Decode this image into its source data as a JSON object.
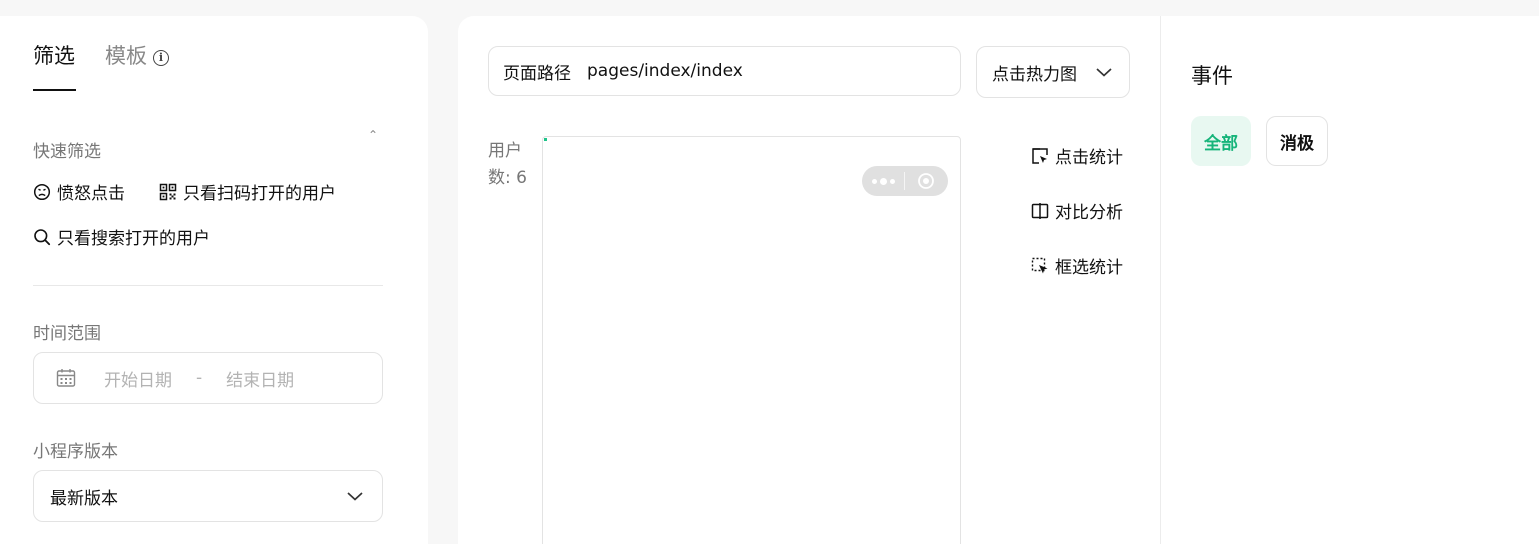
{
  "filter_panel": {
    "tabs": [
      {
        "label": "筛选",
        "active": true
      },
      {
        "label": "模板",
        "active": false
      }
    ],
    "info_glyph": "i",
    "quick_filter": {
      "title": "快速筛选",
      "collapse_glyph": "⌃",
      "items": [
        {
          "icon": "angry-face-icon",
          "label": "愤怒点击"
        },
        {
          "icon": "qr-code-icon",
          "label": "只看扫码打开的用户"
        },
        {
          "icon": "search-icon",
          "label": "只看搜索打开的用户"
        }
      ]
    },
    "time_range": {
      "title": "时间范围",
      "start_placeholder": "开始日期",
      "separator": "-",
      "end_placeholder": "结束日期"
    },
    "version": {
      "title": "小程序版本",
      "selected": "最新版本"
    }
  },
  "heatmap": {
    "path_label": "页面路径",
    "path_value": "pages/index/index",
    "mode_selected": "点击热力图",
    "user_count": "用户数: 6",
    "tools": [
      {
        "icon": "click-stats-icon",
        "label": "点击统计"
      },
      {
        "icon": "compare-icon",
        "label": "对比分析"
      },
      {
        "icon": "box-select-icon",
        "label": "框选统计"
      }
    ]
  },
  "events": {
    "title": "事件",
    "chips": [
      {
        "label": "全部",
        "active": true
      },
      {
        "label": "消极",
        "active": false
      }
    ]
  },
  "colors": {
    "accent": "#16b47a",
    "accent_bg": "#e8f8f1",
    "muted_text": "#777777",
    "border": "#e3e3e3"
  }
}
